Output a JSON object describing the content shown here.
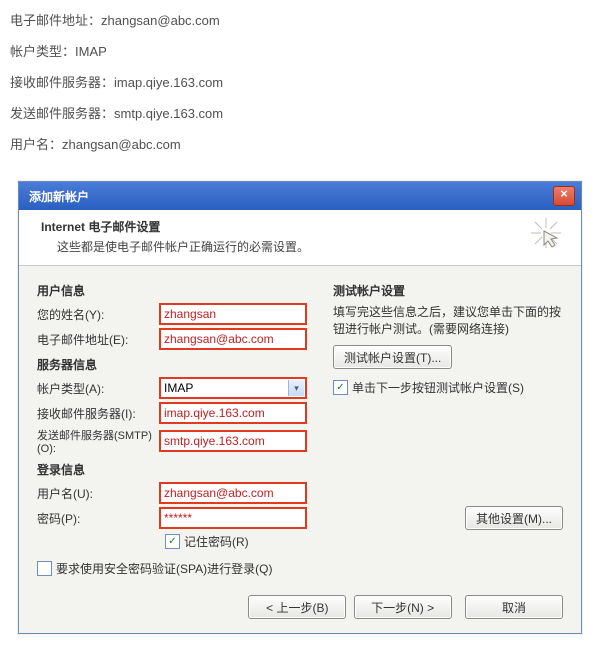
{
  "top": {
    "email_label": "电子邮件地址：",
    "email_value": "zhangsan@abc.com",
    "type_label": "帐户类型：",
    "type_value": "IMAP",
    "incoming_label": "接收邮件服务器：",
    "incoming_value": "imap.qiye.163.com",
    "outgoing_label": "发送邮件服务器：",
    "outgoing_value": "smtp.qiye.163.com",
    "username_label": "用户名：",
    "username_value": "zhangsan@abc.com"
  },
  "dialog": {
    "title": "添加新帐户",
    "close": "×",
    "header_title": "Internet 电子邮件设置",
    "header_sub": "这些都是使电子邮件帐户正确运行的必需设置。"
  },
  "left": {
    "sec_user": "用户信息",
    "name_label": "您的姓名(Y):",
    "name_value": "zhangsan",
    "email_label": "电子邮件地址(E):",
    "email_value": "zhangsan@abc.com",
    "sec_server": "服务器信息",
    "type_label": "帐户类型(A):",
    "type_value": "IMAP",
    "incoming_label": "接收邮件服务器(I):",
    "incoming_value": "imap.qiye.163.com",
    "outgoing_label": "发送邮件服务器(SMTP)(O):",
    "outgoing_value": "smtp.qiye.163.com",
    "sec_login": "登录信息",
    "user_label": "用户名(U):",
    "user_value": "zhangsan@abc.com",
    "pass_label": "密码(P):",
    "pass_value": "******",
    "remember_label": "记住密码(R)",
    "spa_label": "要求使用安全密码验证(SPA)进行登录(Q)"
  },
  "right": {
    "sec_test": "测试帐户设置",
    "hint": "填写完这些信息之后，建议您单击下面的按钮进行帐户测试。(需要网络连接)",
    "test_btn": "测试帐户设置(T)...",
    "next_test_label": "单击下一步按钮测试帐户设置(S)",
    "more_btn": "其他设置(M)..."
  },
  "footer": {
    "back": "< 上一步(B)",
    "next": "下一步(N) >",
    "cancel": "取消"
  }
}
